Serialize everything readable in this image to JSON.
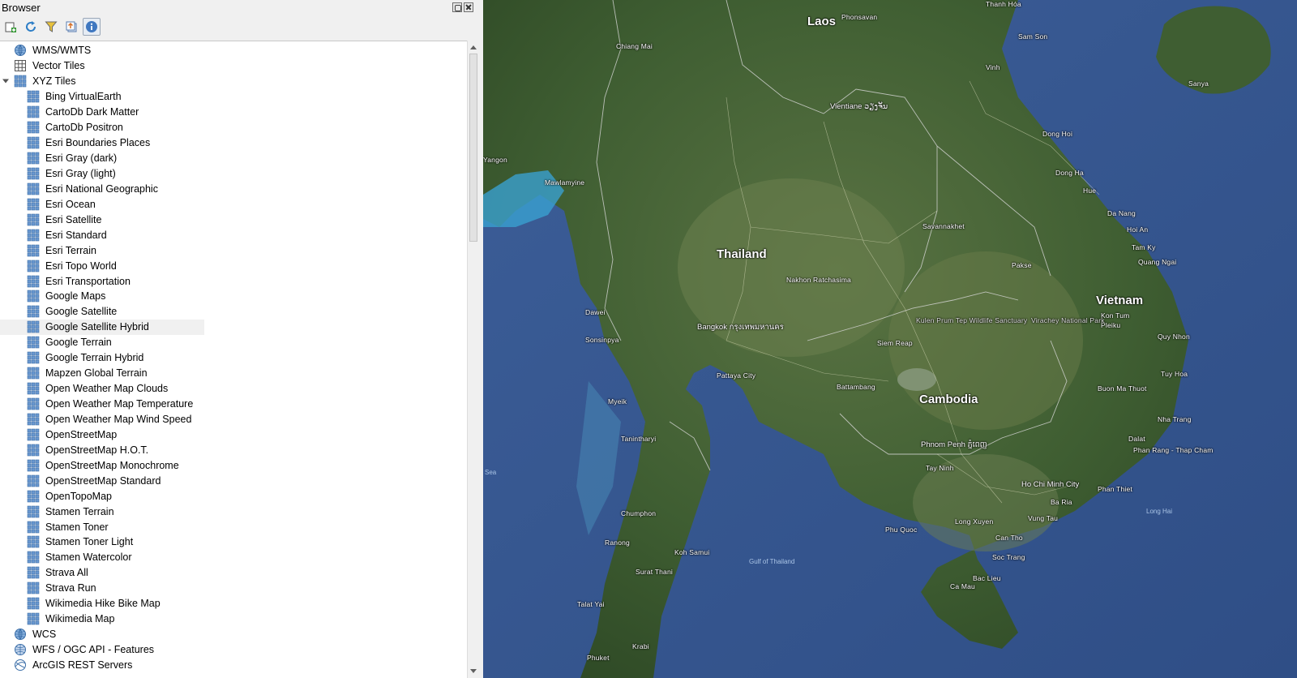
{
  "panel": {
    "title": "Browser"
  },
  "toolbar": {
    "buttons": [
      {
        "name": "add-layer",
        "icon": "add-layer-icon"
      },
      {
        "name": "refresh",
        "icon": "refresh-icon"
      },
      {
        "name": "filter",
        "icon": "filter-icon"
      },
      {
        "name": "collapse-all",
        "icon": "collapse-all-icon"
      },
      {
        "name": "properties",
        "icon": "info-icon"
      }
    ]
  },
  "tree": {
    "wms": "WMS/WMTS",
    "vector_tiles": "Vector Tiles",
    "xyz_tiles": "XYZ Tiles",
    "xyz_children": [
      "Bing VirtualEarth",
      "CartoDb Dark Matter",
      "CartoDb Positron",
      "Esri Boundaries Places",
      "Esri Gray (dark)",
      "Esri Gray (light)",
      "Esri National Geographic",
      "Esri Ocean",
      "Esri Satellite",
      "Esri Standard",
      "Esri Terrain",
      "Esri Topo World",
      "Esri Transportation",
      "Google Maps",
      "Google Satellite",
      "Google Satellite Hybrid",
      "Google Terrain",
      "Google Terrain Hybrid",
      "Mapzen Global Terrain",
      "Open Weather Map Clouds",
      "Open Weather Map Temperature",
      "Open Weather Map Wind Speed",
      "OpenStreetMap",
      "OpenStreetMap H.O.T.",
      "OpenStreetMap Monochrome",
      "OpenStreetMap Standard",
      "OpenTopoMap",
      "Stamen Terrain",
      "Stamen Toner",
      "Stamen Toner Light",
      "Stamen Watercolor",
      "Strava All",
      "Strava Run",
      "Wikimedia Hike Bike Map",
      "Wikimedia Map"
    ],
    "selected_item": "Google Satellite Hybrid",
    "wcs": "WCS",
    "wfs": "WFS / OGC API - Features",
    "arcgis": "ArcGIS REST Servers"
  },
  "map": {
    "countries": [
      "Laos",
      "Thailand",
      "Cambodia",
      "Vietnam"
    ],
    "cities": [
      "Vientiane ວຽງຈັນ",
      "Bangkok กรุงเทพมหานคร",
      "Phnom Penh ភ្នំពេញ",
      "Ho Chi Minh City",
      "Da Nang",
      "Hue",
      "Vinh",
      "Thanh Hóa",
      "Sanya",
      "Pakse",
      "Siem Reap",
      "Battambang",
      "Pattaya City",
      "Yangon",
      "Mawlamyine",
      "Dawei",
      "Myeik",
      "Koh Samui",
      "Surat Thani",
      "Buon Ma Thuot",
      "Quy Nhon",
      "Nha Trang",
      "Phan Thiet",
      "Vung Tau",
      "Can Tho",
      "Long Xuyen",
      "Phu Quoc",
      "Kon Tum",
      "Pleiku",
      "Chiang Mai",
      "Phonsavan",
      "Savannakhet",
      "Nakhon Ratchasima",
      "Sonsinpya",
      "Tanintharyi",
      "Chumphon",
      "Ranong",
      "Krabi",
      "Phuket",
      "Talat Yai",
      "Bac Lieu",
      "Ca Mau",
      "Soc Trang",
      "Ba Ria",
      "Tay Ninh",
      "Dalat",
      "Phan Rang - Thap Cham",
      "Tuy Hoa",
      "Hoi An",
      "Tam Ky",
      "Quang Ngai",
      "Dong Hoi",
      "Dong Ha",
      "Sam Son"
    ],
    "water_labels": [
      "Gulf of Thailand",
      "Long Hai",
      "Sea"
    ],
    "park_labels": [
      "Virachey National Park",
      "Kulen Prum Tep Wildlife Sanctuary"
    ]
  },
  "colors": {
    "panel_bg": "#f0f0f0",
    "tree_bg": "#ffffff",
    "selection": "#f0f0f0",
    "icon_blue": "#4a7bb8",
    "sea": "#3b5b91",
    "land": "#4d6a3a"
  }
}
